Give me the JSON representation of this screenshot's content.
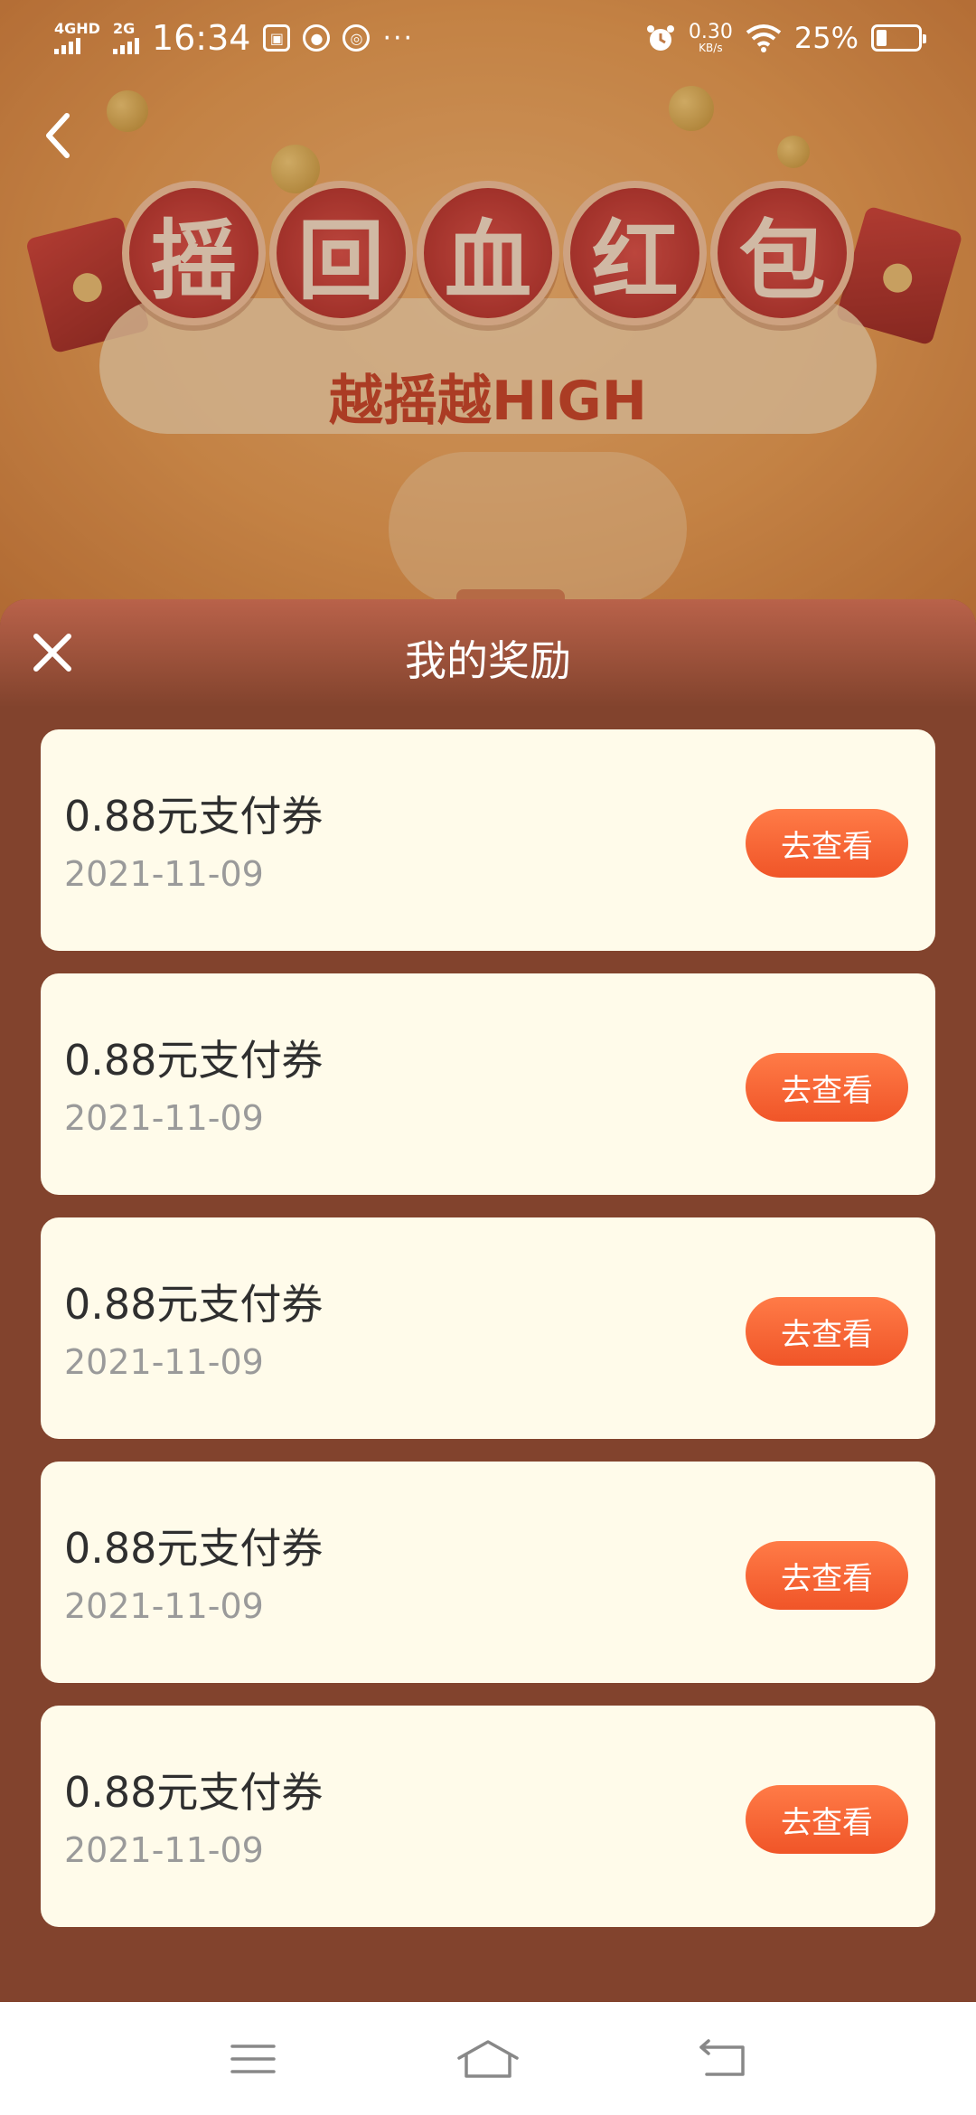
{
  "status_bar": {
    "network_1": "4GHD",
    "network_2": "2G",
    "time": "16:34",
    "net_speed_value": "0.30",
    "net_speed_unit": "KB/s",
    "battery_percent": "25%",
    "battery_level": 0.25
  },
  "banner": {
    "title_chars": [
      "摇",
      "回",
      "血",
      "红",
      "包"
    ],
    "subtitle": "越摇越HIGH"
  },
  "sheet": {
    "title": "我的奖励",
    "rewards": [
      {
        "name": "0.88元支付券",
        "date": "2021-11-09",
        "button": "去查看"
      },
      {
        "name": "0.88元支付券",
        "date": "2021-11-09",
        "button": "去查看"
      },
      {
        "name": "0.88元支付券",
        "date": "2021-11-09",
        "button": "去查看"
      },
      {
        "name": "0.88元支付券",
        "date": "2021-11-09",
        "button": "去查看"
      },
      {
        "name": "0.88元支付券",
        "date": "2021-11-09",
        "button": "去查看"
      }
    ]
  },
  "colors": {
    "sheet_bg": "#82432d",
    "card_bg": "#fffbea",
    "button_accent": "#f05528"
  },
  "icons": {
    "back": "back-chevron-icon",
    "close": "close-icon",
    "nav_menu": "menu-icon",
    "nav_home": "home-icon",
    "nav_back": "back-arrow-icon"
  }
}
